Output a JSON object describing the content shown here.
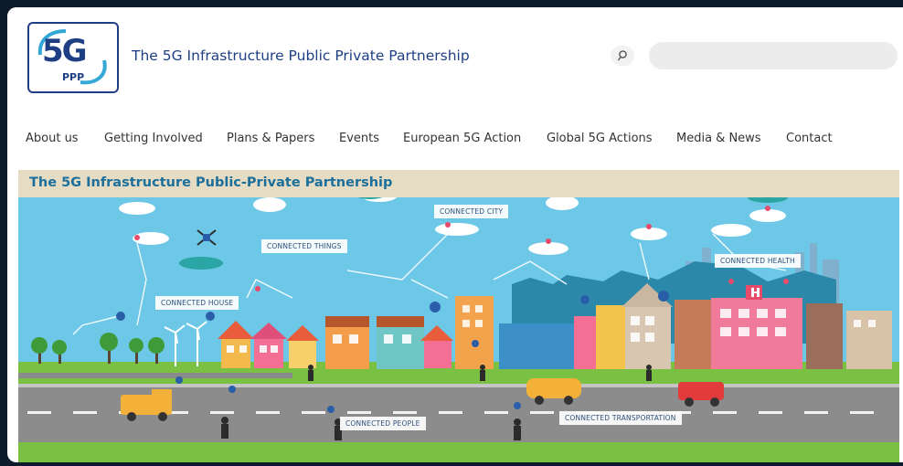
{
  "header": {
    "logo": {
      "main": "5G",
      "sub": "PPP"
    },
    "site_title": "The 5G Infrastructure Public Private Partnership",
    "search": {
      "icon": "search-icon",
      "placeholder": ""
    }
  },
  "nav": {
    "items": [
      {
        "label": "About us"
      },
      {
        "label": "Getting Involved"
      },
      {
        "label": "Plans & Papers"
      },
      {
        "label": "Events"
      },
      {
        "label": "European 5G Action"
      },
      {
        "label": "Global 5G Actions"
      },
      {
        "label": "Media & News"
      },
      {
        "label": "Contact"
      }
    ]
  },
  "banner": {
    "title": "The 5G Infrastructure Public-Private Partnership",
    "labels": {
      "connected_city": "CONNECTED CITY",
      "connected_things": "CONNECTED THINGS",
      "connected_house": "CONNECTED HOUSE",
      "connected_health": "CONNECTED HEALTH",
      "connected_people": "CONNECTED PEOPLE",
      "connected_transportation": "CONNECTED TRANSPORTATION"
    }
  },
  "colors": {
    "brand_blue": "#1f3f85",
    "title_teal": "#1b6f9a",
    "sky": "#6dc7e6",
    "grass": "#7ac143",
    "road": "#8c8c8c"
  }
}
